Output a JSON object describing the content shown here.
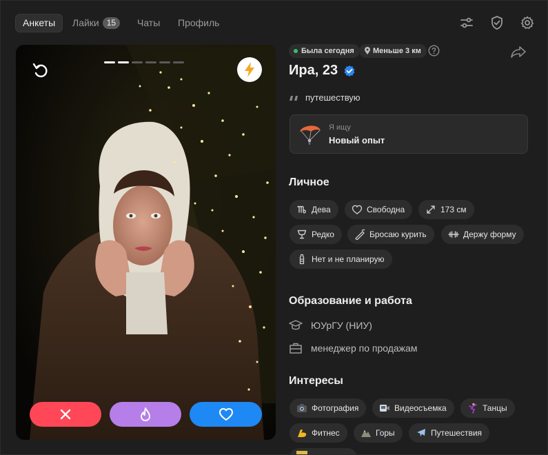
{
  "nav": {
    "tabs": [
      {
        "label": "Анкеты"
      },
      {
        "label": "Лайки",
        "badge": "15"
      },
      {
        "label": "Чаты"
      },
      {
        "label": "Профиль"
      }
    ],
    "icons": [
      "filters-icon",
      "shield-check-icon",
      "gear-icon"
    ]
  },
  "photo": {
    "story_count": 6,
    "story_active": 2,
    "icons": {
      "undo": "undo-icon",
      "boost": "lightning-icon"
    },
    "actions": {
      "dislike": "close-icon",
      "superlike": "flame-icon",
      "like": "heart-icon"
    }
  },
  "profile": {
    "status": "Была сегодня",
    "distance": "Меньше 3 км",
    "name": "Ира, 23",
    "verified": true,
    "bio": "путешествую",
    "looking_for": {
      "label": "Я ищу",
      "value": "Новый опыт",
      "icon": "parachute-icon"
    }
  },
  "personal": {
    "title": "Личное",
    "tags": [
      {
        "label": "Дева",
        "icon": "virgo-icon"
      },
      {
        "label": "Свободна",
        "icon": "heart-outline-icon"
      },
      {
        "label": "173 см",
        "icon": "height-icon"
      },
      {
        "label": "Редко",
        "icon": "glass-icon"
      },
      {
        "label": "Бросаю курить",
        "icon": "cigarette-icon"
      },
      {
        "label": "Держу форму",
        "icon": "dumbbell-icon"
      },
      {
        "label": "Нет и не планирую",
        "icon": "baby-bottle-icon"
      }
    ]
  },
  "education": {
    "title": "Образование и работа",
    "university": "ЮУрГУ (НИУ)",
    "job": "менеджер по продажам"
  },
  "interests": {
    "title": "Интересы",
    "tags": [
      {
        "label": "Фотография",
        "icon": "camera-icon"
      },
      {
        "label": "Видеосъемка",
        "icon": "video-camera-icon"
      },
      {
        "label": "Танцы",
        "icon": "dancer-icon"
      },
      {
        "label": "Фитнес",
        "icon": "flexed-biceps-icon"
      },
      {
        "label": "Горы",
        "icon": "mountain-icon"
      },
      {
        "label": "Путешествия",
        "icon": "airplane-icon"
      }
    ]
  },
  "colors": {
    "dislike": "#ff4757",
    "superlike": "#b57ee8",
    "like": "#1e88f5",
    "online": "#33c26a",
    "verified": "#2a86f0"
  }
}
